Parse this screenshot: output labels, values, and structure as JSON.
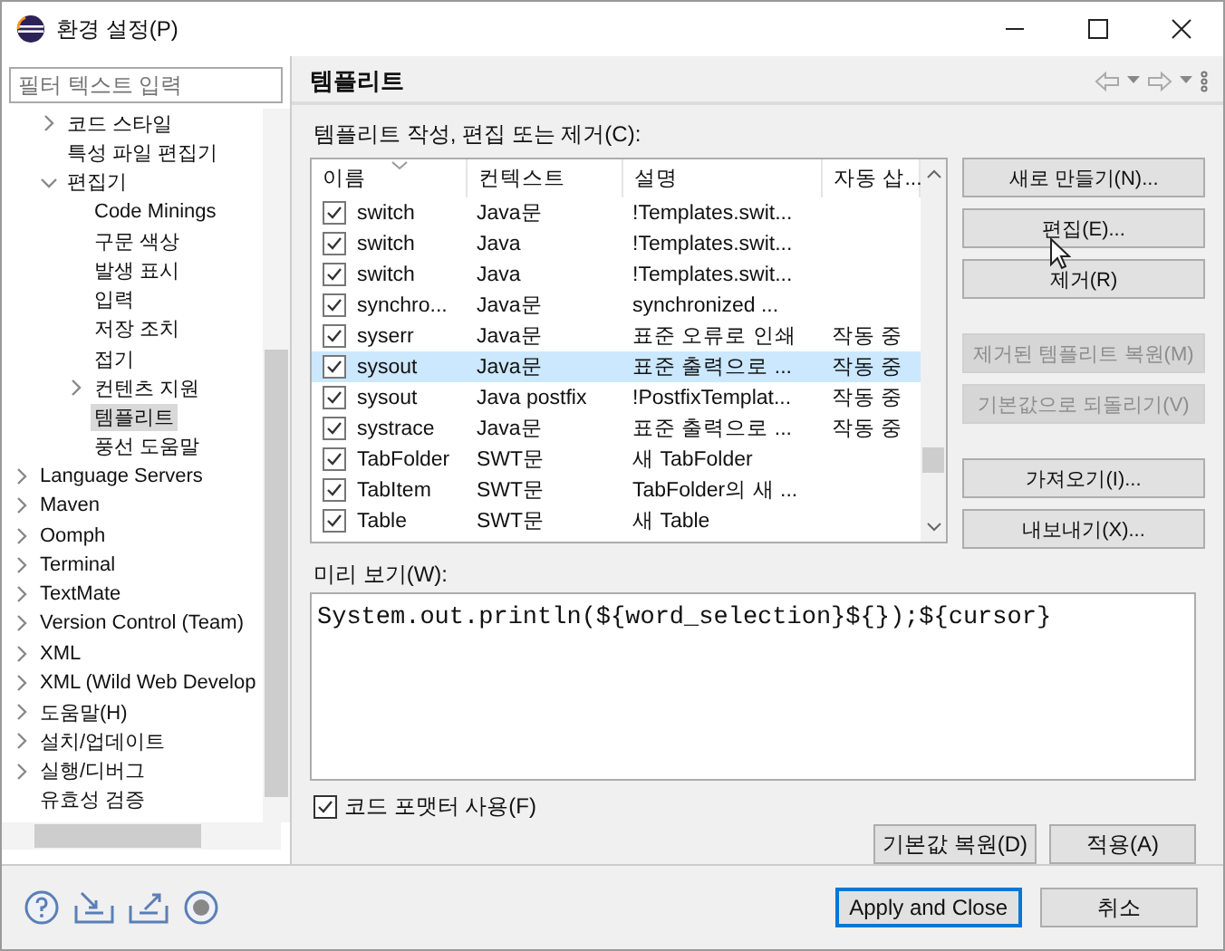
{
  "window": {
    "title": "환경 설정(P)"
  },
  "filter": {
    "placeholder": "필터 텍스트 입력"
  },
  "tree_continued": [
    {
      "label": "코드 스타일",
      "expandable": true,
      "expanded": false,
      "selected": false
    },
    {
      "label": "특성 파일 편집기",
      "expandable": false,
      "selected": false
    },
    {
      "label": "편집기",
      "expandable": true,
      "expanded": true,
      "selected": false,
      "children": [
        {
          "label": "Code Minings",
          "expandable": false,
          "selected": false
        },
        {
          "label": "구문 색상",
          "expandable": false,
          "selected": false
        },
        {
          "label": "발생 표시",
          "expandable": false,
          "selected": false
        },
        {
          "label": "입력",
          "expandable": false,
          "selected": false
        },
        {
          "label": "저장 조치",
          "expandable": false,
          "selected": false
        },
        {
          "label": "접기",
          "expandable": false,
          "selected": false
        },
        {
          "label": "컨텐츠 지원",
          "expandable": true,
          "expanded": false,
          "selected": false
        },
        {
          "label": "템플리트",
          "expandable": false,
          "selected": true
        },
        {
          "label": "풍선 도움말",
          "expandable": false,
          "selected": false
        }
      ]
    }
  ],
  "tree_items": [
    {
      "label": "Language Servers",
      "expandable": true,
      "expanded": false,
      "selected": false
    },
    {
      "label": "Maven",
      "expandable": true,
      "expanded": false,
      "selected": false
    },
    {
      "label": "Oomph",
      "expandable": true,
      "expanded": false,
      "selected": false
    },
    {
      "label": "Terminal",
      "expandable": true,
      "expanded": false,
      "selected": false
    },
    {
      "label": "TextMate",
      "expandable": true,
      "expanded": false,
      "selected": false
    },
    {
      "label": "Version Control (Team)",
      "expandable": true,
      "expanded": false,
      "selected": false
    },
    {
      "label": "XML",
      "expandable": true,
      "expanded": false,
      "selected": false
    },
    {
      "label": "XML (Wild Web Develop",
      "expandable": true,
      "expanded": false,
      "selected": false
    },
    {
      "label": "도움말(H)",
      "expandable": true,
      "expanded": false,
      "selected": false
    },
    {
      "label": "설치/업데이트",
      "expandable": true,
      "expanded": false,
      "selected": false
    },
    {
      "label": "실행/디버그",
      "expandable": true,
      "expanded": false,
      "selected": false
    },
    {
      "label": "유효성 검증",
      "expandable": false,
      "selected": false
    }
  ],
  "page": {
    "title": "템플리트",
    "table_label": "템플리트 작성, 편집 또는 제거(C):"
  },
  "table": {
    "columns": [
      "이름",
      "컨텍스트",
      "설명",
      "자동 삽..."
    ],
    "rows": [
      {
        "checked": true,
        "selected": false,
        "cells": [
          "switch",
          "Java문",
          "!Templates.swit...",
          ""
        ]
      },
      {
        "checked": true,
        "selected": false,
        "cells": [
          "switch",
          "Java",
          "!Templates.swit...",
          ""
        ]
      },
      {
        "checked": true,
        "selected": false,
        "cells": [
          "switch",
          "Java",
          "!Templates.swit...",
          ""
        ]
      },
      {
        "checked": true,
        "selected": false,
        "cells": [
          "synchro...",
          "Java문",
          "synchronized ...",
          ""
        ]
      },
      {
        "checked": true,
        "selected": false,
        "cells": [
          "syserr",
          "Java문",
          "표준 오류로 인쇄",
          "작동 중"
        ]
      },
      {
        "checked": true,
        "selected": true,
        "cells": [
          "sysout",
          "Java문",
          "표준 출력으로 ...",
          "작동 중"
        ]
      },
      {
        "checked": true,
        "selected": false,
        "cells": [
          "sysout",
          "Java postfix",
          "!PostfixTemplat...",
          "작동 중"
        ]
      },
      {
        "checked": true,
        "selected": false,
        "cells": [
          "systrace",
          "Java문",
          "표준 출력으로 ...",
          "작동 중"
        ]
      },
      {
        "checked": true,
        "selected": false,
        "cells": [
          "TabFolder",
          "SWT문",
          "새 TabFolder",
          ""
        ]
      },
      {
        "checked": true,
        "selected": false,
        "cells": [
          "TabItem",
          "SWT문",
          "TabFolder의 새 ...",
          ""
        ]
      },
      {
        "checked": true,
        "selected": false,
        "cells": [
          "Table",
          "SWT문",
          "새 Table",
          ""
        ]
      }
    ]
  },
  "side_buttons": [
    {
      "label": "새로 만들기(N)...",
      "disabled": false
    },
    {
      "label": "편집(E)...",
      "disabled": false
    },
    {
      "label": "제거(R)",
      "disabled": false
    },
    {
      "label": "제거된 템플리트 복원(M)",
      "disabled": true
    },
    {
      "label": "기본값으로 되돌리기(V)",
      "disabled": true
    },
    {
      "label": "가져오기(I)...",
      "disabled": false
    },
    {
      "label": "내보내기(X)...",
      "disabled": false
    }
  ],
  "preview": {
    "label": "미리 보기(W):",
    "code": "System.out.println(${word_selection}${});${cursor}"
  },
  "formatter": {
    "label": "코드 포맷터 사용(F)",
    "checked": true
  },
  "page_buttons": [
    "기본값 복원(D)",
    "적용(A)"
  ],
  "dialog_buttons": [
    {
      "label": "Apply and Close",
      "default": true
    },
    {
      "label": "취소",
      "default": false
    }
  ]
}
